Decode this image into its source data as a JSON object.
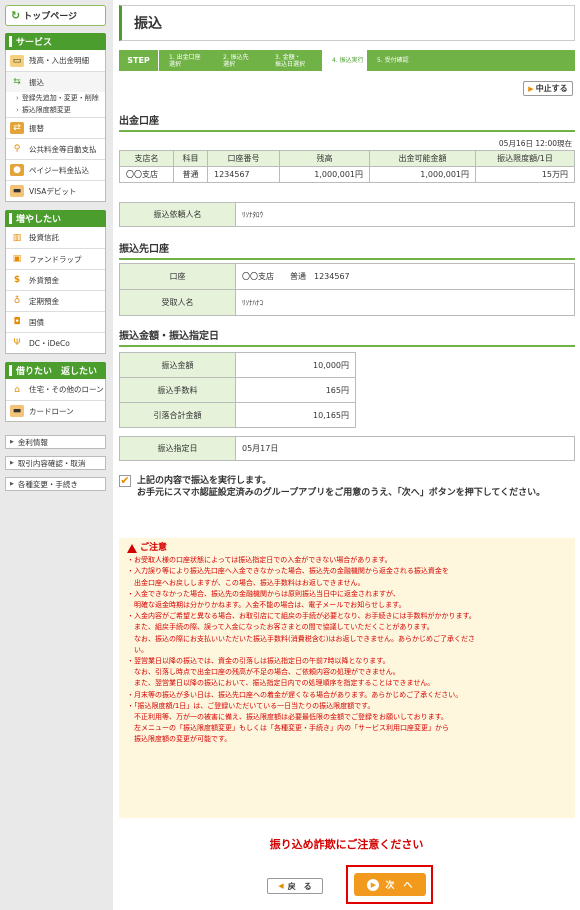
{
  "sidebar": {
    "top_label": "トップページ",
    "services_title": "サービス",
    "services": [
      {
        "label": "残高・入出金明細",
        "icon": "wallet-icon"
      },
      {
        "label": "振込",
        "icon": "transfer-icon"
      },
      {
        "label": "振替",
        "icon": "swap-icon"
      },
      {
        "label": "公共料金等自動支払",
        "icon": "faucet-icon"
      },
      {
        "label": "ペイジー料金払込",
        "icon": "payeasy-icon"
      },
      {
        "label": "VISAデビット",
        "icon": "card-icon"
      }
    ],
    "transfer_sub": [
      "登録先追加・変更・削除",
      "振込限度額変更"
    ],
    "grow_title": "増やしたい",
    "grow": [
      {
        "label": "投資信託",
        "icon": "chart-icon"
      },
      {
        "label": "ファンドラップ",
        "icon": "gift-icon"
      },
      {
        "label": "外貨預金",
        "icon": "dollar-icon"
      },
      {
        "label": "定期預金",
        "icon": "moneybag-icon"
      },
      {
        "label": "国債",
        "icon": "flag-icon"
      },
      {
        "label": "DC・iDeCo",
        "icon": "sprout-icon"
      }
    ],
    "borrow_title": "借りたい　返したい",
    "borrow": [
      {
        "label": "住宅・その他のローン",
        "icon": "house-icon"
      },
      {
        "label": "カードローン",
        "icon": "loancard-icon"
      }
    ],
    "plain": [
      "金利情報",
      "取引内容確認・取消",
      "各種変更・手続き"
    ]
  },
  "page_title": "振込",
  "steps": {
    "label": "STEP",
    "items": [
      "1. 出金口座\n選択",
      "2. 振込先\n選択",
      "3. 金額・\n振込日選択",
      "4. 振込実行",
      "5. 受付確認"
    ],
    "current": 3
  },
  "stop_label": "中止する",
  "source": {
    "title": "出金口座",
    "date": "05月16日 12:00現在",
    "headers": [
      "支店名",
      "科目",
      "口座番号",
      "残高",
      "出金可能金額",
      "振込限度額/1日"
    ],
    "row": [
      "〇〇支店",
      "普通",
      "1234567",
      "1,000,001円",
      "1,000,001円",
      "15万円"
    ],
    "requester_label": "振込依頼人名",
    "requester": "ﾘｿﾅﾀﾛｳ"
  },
  "dest": {
    "title": "振込先口座",
    "account_label": "口座",
    "account": "〇〇支店　　普通　1234567",
    "recipient_label": "受取人名",
    "recipient": "ﾘｿﾅﾊﾅｺ"
  },
  "amount": {
    "title": "振込金額・振込指定日",
    "rows": [
      {
        "label": "振込金額",
        "value": "10,000円"
      },
      {
        "label": "振込手数料",
        "value": "165円"
      },
      {
        "label": "引落合計金額",
        "value": "10,165円"
      }
    ],
    "date_label": "振込指定日",
    "date": "05月17日"
  },
  "confirm": {
    "line1": "上記の内容で振込を実行します。",
    "line2": "お手元にスマホ認証設定済みのグループアプリをご用意のうえ、「次へ」ボタンを押下してください。"
  },
  "notice": {
    "title": "ご注意",
    "lines": [
      "・お受取人様の口座状態によっては振込指定日での入金ができない場合があります。",
      "・入力誤り等により振込先口座へ入金できなかった場合、振込先の金融機関から返金される振込資金を",
      "　出金口座へお戻ししますが、この場合、振込手数料はお返しできません。",
      "・入金できなかった場合、振込先の金融機関からは原則振込当日中に返金されますが、",
      "　明確な返金時期は分かりかねます。入金不能の場合は、電子メールでお知らせします。",
      "・入金内容がご希望と異なる場合、お取引店にて組戻の手続が必要となり、お手続きには手数料がかかります。",
      "　また、組戻手続の際、誤って入金になったお客さまとの間で協議していただくことがあります。",
      "　なお、振込の際にお支払いいただいた振込手数料(消費税含む)はお返しできません。あらかじめご了承くださ",
      "　い。",
      "・翌営業日以降の振込では、資金の引落しは振込指定日の午前7時以降となります。",
      "　なお、引落し時点で出金口座の残高が不足の場合、ご依頼内容の処理ができません。",
      "　また、翌営業日以降の振込において、振込指定日内での処理順序を指定することはできません。",
      "・月末等の振込が多い日は、振込先口座への着金が遅くなる場合があります。あらかじめご了承ください。",
      "・「振込限度額/1日」は、ご登録いただいている一日当たりの振込限度額です。",
      "　不正利用等、万が一の被害に備え、振込限度額は必要最低限の金額でご登録をお願いしております。",
      "　左メニューの「振込限度額変更」もしくは「各種変更・手続き」内の「サービス利用口座変更」から",
      "　振込限度額の変更が可能です。"
    ]
  },
  "fraud_warning": "振り込め詐欺にご注意ください",
  "back_label": "戻　る",
  "next_label": "次　へ",
  "colors": {
    "green": "#4b9e2d",
    "step_green": "#70b246",
    "orange": "#f29a1d",
    "red": "#d40000"
  }
}
